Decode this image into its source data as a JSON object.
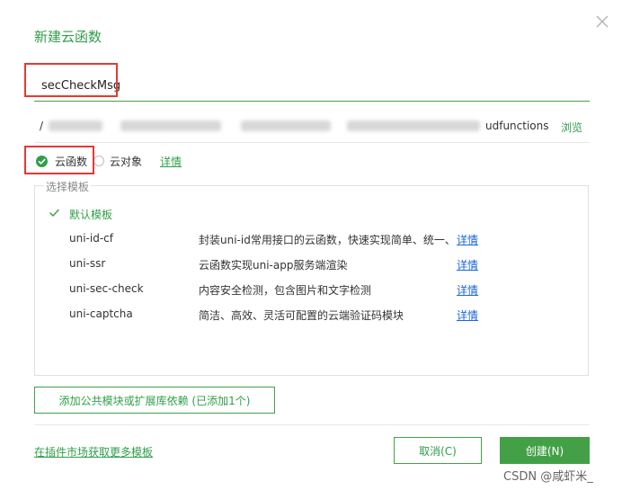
{
  "dialog": {
    "title": "新建云函数"
  },
  "name_input": {
    "value": "secCheckMsg"
  },
  "path": {
    "prefix": "/",
    "suffix": "udfunctions",
    "browse_label": "浏览"
  },
  "type_selector": {
    "cloud_function_label": "云函数",
    "cloud_object_label": "云对象",
    "detail_label": "详情"
  },
  "templates": {
    "legend": "选择模板",
    "items": [
      {
        "name": "默认模板",
        "desc": "",
        "detail": "",
        "selected": true
      },
      {
        "name": "uni-id-cf",
        "desc": "封装uni-id常用接口的云函数，快速实现简单、统一、",
        "detail": "详情",
        "selected": false
      },
      {
        "name": "uni-ssr",
        "desc": "云函数实现uni-app服务端渲染",
        "detail": "详情",
        "selected": false
      },
      {
        "name": "uni-sec-check",
        "desc": "内容安全检测，包含图片和文字检测",
        "detail": "详情",
        "selected": false
      },
      {
        "name": "uni-captcha",
        "desc": "简洁、高效、灵活可配置的云端验证码模块",
        "detail": "详情",
        "selected": false
      }
    ]
  },
  "add_module_label": "添加公共模块或扩展库依赖 (已添加1个)",
  "market_link_label": "在插件市场获取更多模板",
  "cancel_label": "取消(C)",
  "create_label": "创建(N)",
  "watermark": "CSDN @咸虾米_",
  "colors": {
    "accent": "#43a047",
    "highlight": "#e53935",
    "link_blue": "#1a66d9"
  }
}
